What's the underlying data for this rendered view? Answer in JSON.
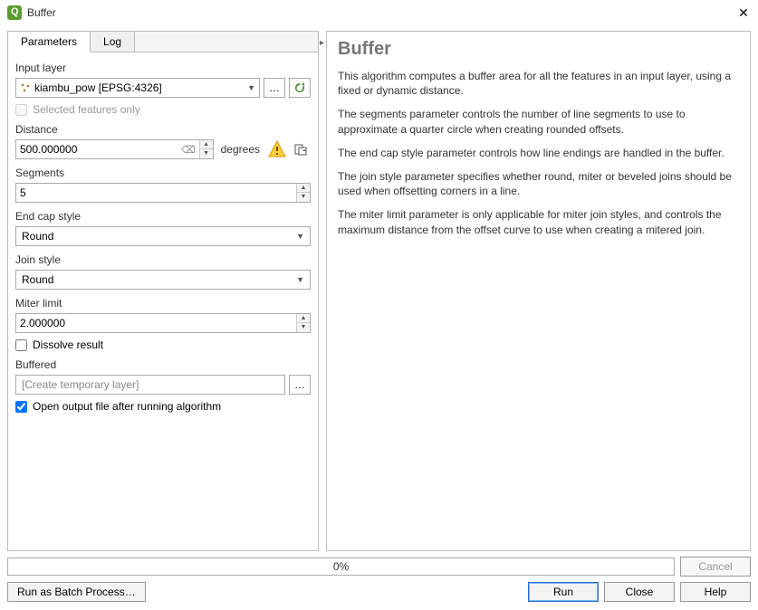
{
  "window": {
    "title": "Buffer"
  },
  "tabs": {
    "parameters": "Parameters",
    "log": "Log"
  },
  "form": {
    "input_layer_label": "Input layer",
    "input_layer_value": "kiambu_pow [EPSG:4326]",
    "selected_features_label": "Selected features only",
    "distance_label": "Distance",
    "distance_value": "500.000000",
    "distance_unit": "degrees",
    "segments_label": "Segments",
    "segments_value": "5",
    "endcap_label": "End cap style",
    "endcap_value": "Round",
    "joinstyle_label": "Join style",
    "joinstyle_value": "Round",
    "miter_label": "Miter limit",
    "miter_value": "2.000000",
    "dissolve_label": "Dissolve result",
    "buffered_label": "Buffered",
    "buffered_placeholder": "[Create temporary layer]",
    "open_after_label": "Open output file after running algorithm"
  },
  "help": {
    "title": "Buffer",
    "p1": "This algorithm computes a buffer area for all the features in an input layer, using a fixed or dynamic distance.",
    "p2": "The segments parameter controls the number of line segments to use to approximate a quarter circle when creating rounded offsets.",
    "p3": "The end cap style parameter controls how line endings are handled in the buffer.",
    "p4": "The join style parameter specifies whether round, miter or beveled joins should be used when offsetting corners in a line.",
    "p5": "The miter limit parameter is only applicable for miter join styles, and controls the maximum distance from the offset curve to use when creating a mitered join."
  },
  "progress": {
    "text": "0%"
  },
  "buttons": {
    "cancel": "Cancel",
    "batch": "Run as Batch Process…",
    "run": "Run",
    "close": "Close",
    "helpbtn": "Help"
  }
}
